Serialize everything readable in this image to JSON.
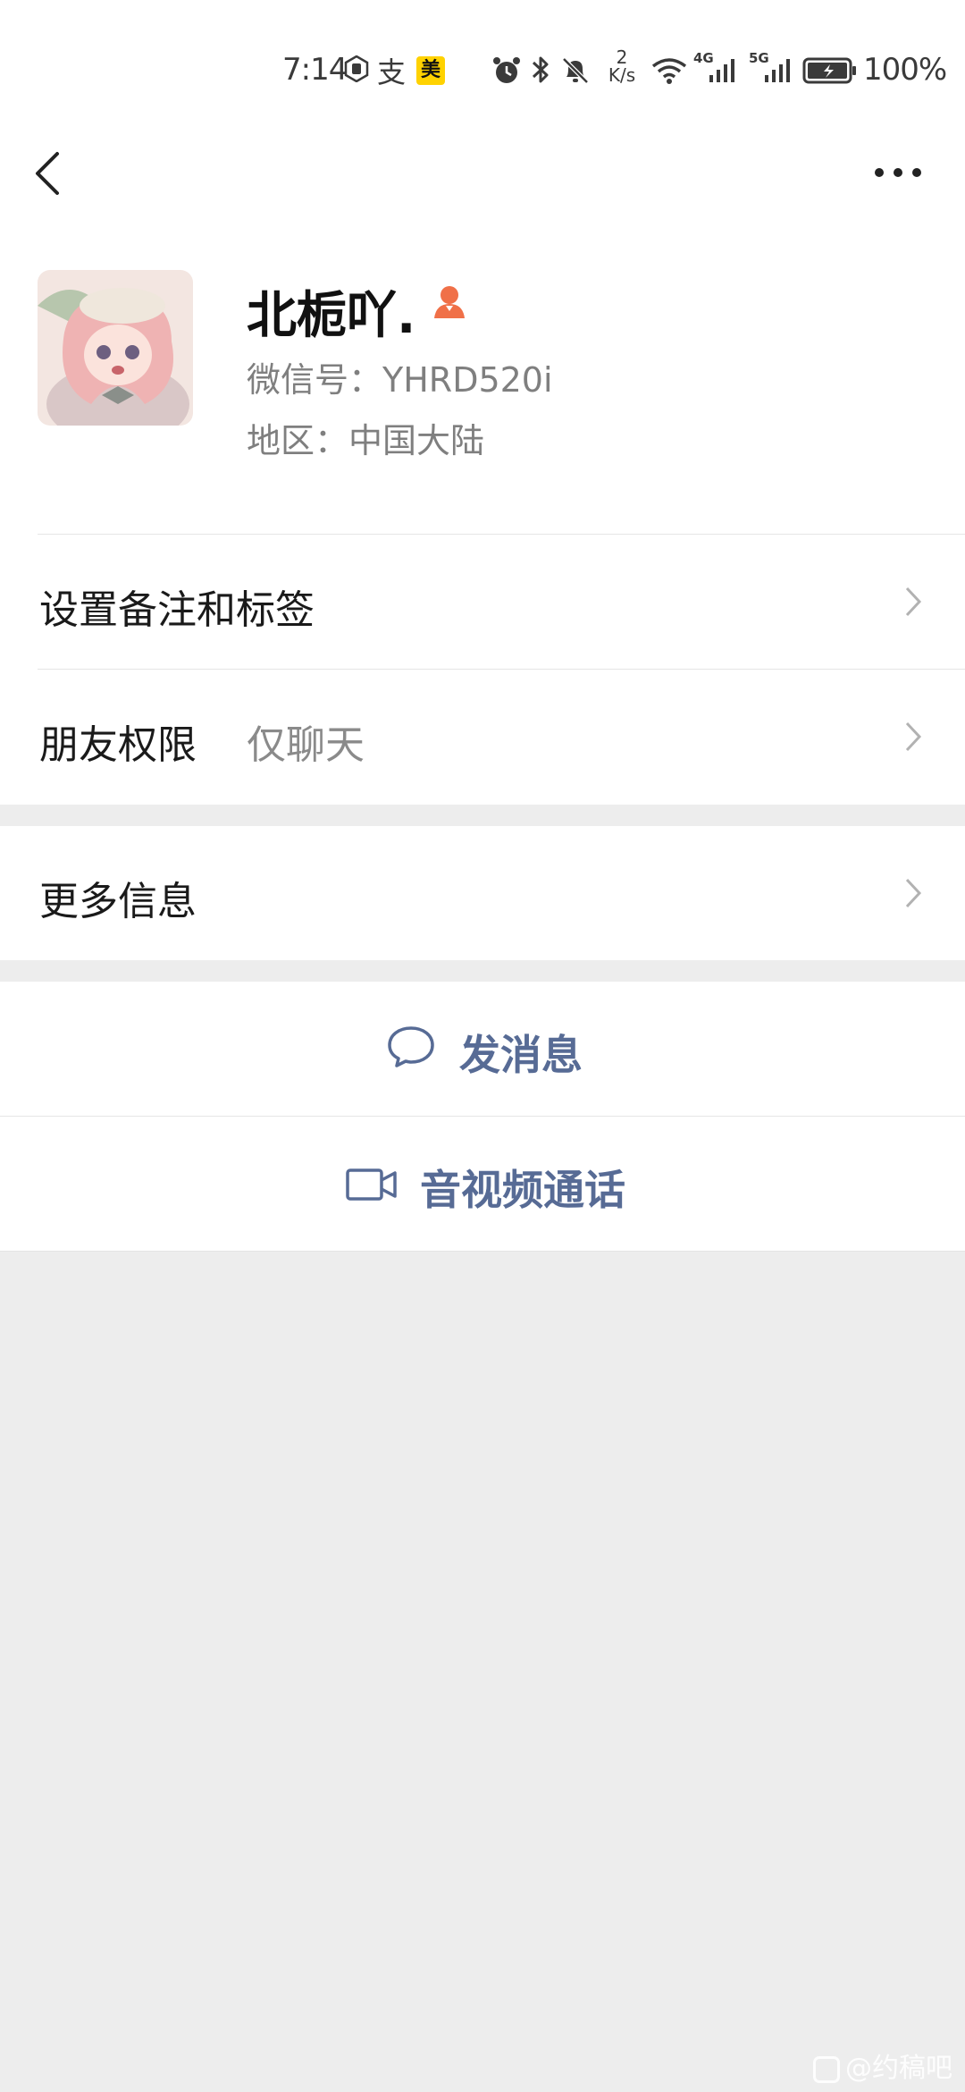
{
  "status_bar": {
    "time": "7:14",
    "zhi_glyph": "支",
    "mei_badge": "美",
    "speed_top": "2",
    "speed_bottom": "K/s",
    "net1": "4G",
    "net2": "5G",
    "battery": "100%",
    "icons": [
      "hand-icon",
      "alarm-icon",
      "bluetooth-icon",
      "mute-bell-icon",
      "wifi-icon",
      "signal-icon",
      "signal-icon",
      "battery-charging-icon"
    ]
  },
  "nav": {
    "back_icon": "chevron-left-icon",
    "more_icon": "more-dots-icon"
  },
  "profile": {
    "nickname": "北栀吖.",
    "gender_icon": "female-icon",
    "wechat_id": "微信号：YHRD520i",
    "region": "地区：中国大陆"
  },
  "rows": {
    "remark_label": "设置备注和标签",
    "permission_label": "朋友权限",
    "permission_value": "仅聊天",
    "more_info_label": "更多信息"
  },
  "actions": {
    "message_label": "发消息",
    "call_label": "音视频通话"
  },
  "watermark": "@约稿吧",
  "colors": {
    "link_blue": "#576b95",
    "background_gray": "#ededed",
    "female_icon": "#f07048"
  }
}
